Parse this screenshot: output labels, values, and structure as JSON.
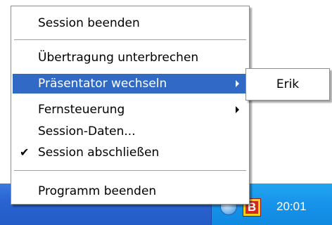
{
  "context_menu": {
    "items": [
      {
        "label": "Session beenden"
      },
      {
        "label": "Übertragung unterbrechen"
      },
      {
        "label": "Präsentator wechseln",
        "submenu": true,
        "highlighted": true
      },
      {
        "label": "Fernsteuerung",
        "submenu": true
      },
      {
        "label": "Session-Daten..."
      },
      {
        "label": "Session abschließen",
        "checked": true
      },
      {
        "label": "Programm beenden"
      }
    ]
  },
  "submenu": {
    "items": [
      {
        "label": "Erik"
      }
    ]
  },
  "taskbar": {
    "tray_icons": [
      "network-icon",
      "b-app-icon"
    ],
    "tray_b_letter": "B",
    "clock": "20:01"
  },
  "colors": {
    "highlight": "#316ac5",
    "taskbar": "#245bc7",
    "tray": "#1693ea"
  }
}
